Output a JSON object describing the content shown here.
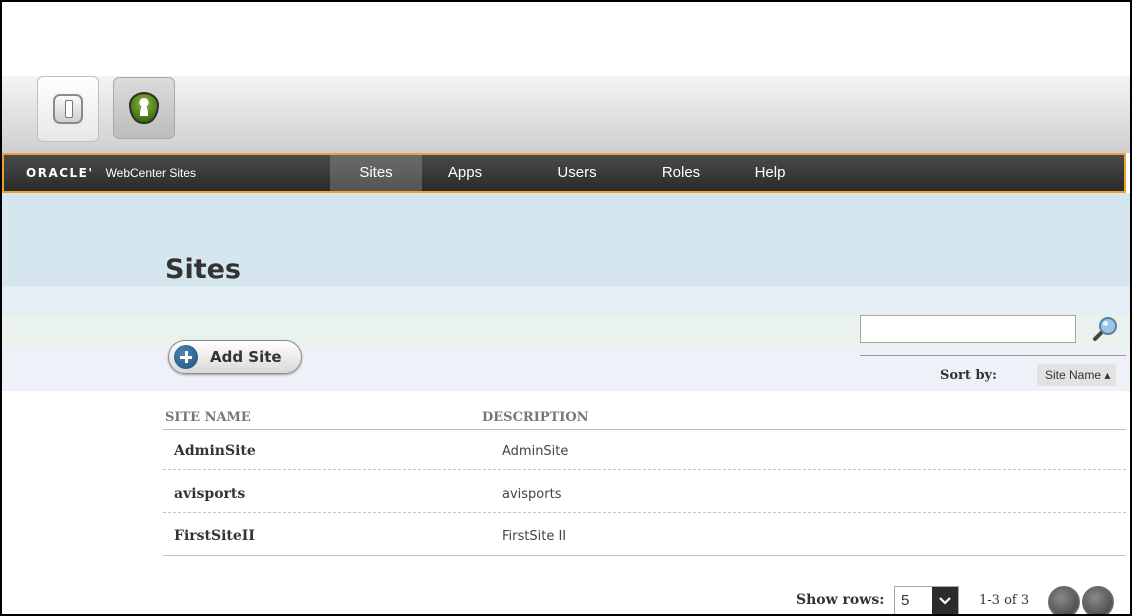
{
  "appbar": {
    "apps": [
      {
        "name": "webcenter-sites-admin",
        "icon": "slot-icon",
        "active": true
      },
      {
        "name": "security",
        "icon": "shield-user-icon",
        "active": false
      }
    ]
  },
  "nav": {
    "brand_logo": "ORACLE'",
    "brand_product": "WebCenter Sites",
    "items": [
      {
        "label": "Sites",
        "active": true
      },
      {
        "label": "Apps",
        "active": false
      },
      {
        "label": "Users",
        "active": false
      },
      {
        "label": "Roles",
        "active": false
      },
      {
        "label": "Help",
        "active": false
      }
    ],
    "accent_color": "#f0a030"
  },
  "page": {
    "title": "Sites",
    "add_button_label": "Add Site",
    "search": {
      "value": "",
      "placeholder": ""
    },
    "sort": {
      "label": "Sort by:",
      "value": "Site Name ▴"
    }
  },
  "table": {
    "columns": [
      "SITE NAME",
      "DESCRIPTION"
    ],
    "rows": [
      {
        "name": "AdminSite",
        "description": "AdminSite"
      },
      {
        "name": "avisports",
        "description": "avisports"
      },
      {
        "name": "FirstSiteII",
        "description": "FirstSite II"
      }
    ]
  },
  "footer": {
    "show_rows_label": "Show rows:",
    "rows_value": "5",
    "range": "1-3 of 3"
  }
}
